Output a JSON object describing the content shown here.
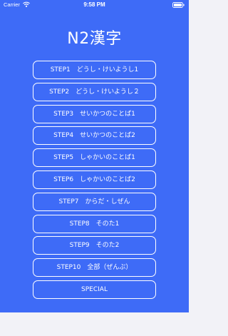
{
  "status_bar": {
    "carrier": "Carrier",
    "time": "9:58 PM"
  },
  "title": "N2漢字",
  "steps": [
    {
      "label": "STEP1　どうし・けいようし1"
    },
    {
      "label": "STEP2　どうし・けいようし２"
    },
    {
      "label": "STEP3　せいかつのことば1"
    },
    {
      "label": "STEP4　せいかつのことば2"
    },
    {
      "label": "STEP5　しゃかいのことば1"
    },
    {
      "label": "STEP6　しゃかいのことば2"
    },
    {
      "label": "STEP7　からだ・しぜん"
    },
    {
      "label": "STEP8　そのた1"
    },
    {
      "label": "STEP9　そのた2"
    },
    {
      "label": "STEP10　全部（ぜんぶ）"
    },
    {
      "label": "SPECIAL"
    }
  ],
  "icons": {
    "wifi": "wifi-icon",
    "battery": "battery-icon"
  },
  "colors": {
    "background": "#3e6bf7",
    "text": "#ffffff",
    "button_border": "#ffffff"
  }
}
